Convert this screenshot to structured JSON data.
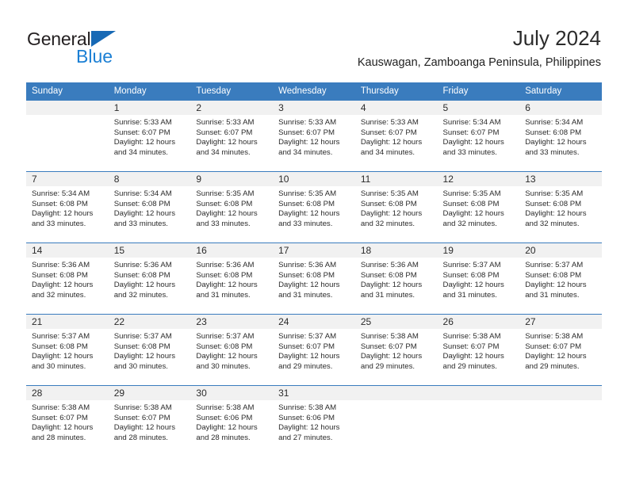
{
  "brand": {
    "name_part1": "General",
    "name_part2": "Blue",
    "triangle_icon": "brand-triangle-icon",
    "accent_color": "#1769b5",
    "secondary_color": "#1b7fd4"
  },
  "header": {
    "title": "July 2024",
    "subtitle": "Kauswagan, Zamboanga Peninsula, Philippines"
  },
  "calendar": {
    "header_bg": "#3a7cbe",
    "daynum_bg": "#f1f1f1",
    "weekday_headers": [
      "Sunday",
      "Monday",
      "Tuesday",
      "Wednesday",
      "Thursday",
      "Friday",
      "Saturday"
    ],
    "weeks": [
      [
        {
          "day": "",
          "sunrise": "",
          "sunset": "",
          "daylight_line1": "",
          "daylight_line2": ""
        },
        {
          "day": "1",
          "sunrise": "Sunrise: 5:33 AM",
          "sunset": "Sunset: 6:07 PM",
          "daylight_line1": "Daylight: 12 hours",
          "daylight_line2": "and 34 minutes."
        },
        {
          "day": "2",
          "sunrise": "Sunrise: 5:33 AM",
          "sunset": "Sunset: 6:07 PM",
          "daylight_line1": "Daylight: 12 hours",
          "daylight_line2": "and 34 minutes."
        },
        {
          "day": "3",
          "sunrise": "Sunrise: 5:33 AM",
          "sunset": "Sunset: 6:07 PM",
          "daylight_line1": "Daylight: 12 hours",
          "daylight_line2": "and 34 minutes."
        },
        {
          "day": "4",
          "sunrise": "Sunrise: 5:33 AM",
          "sunset": "Sunset: 6:07 PM",
          "daylight_line1": "Daylight: 12 hours",
          "daylight_line2": "and 34 minutes."
        },
        {
          "day": "5",
          "sunrise": "Sunrise: 5:34 AM",
          "sunset": "Sunset: 6:07 PM",
          "daylight_line1": "Daylight: 12 hours",
          "daylight_line2": "and 33 minutes."
        },
        {
          "day": "6",
          "sunrise": "Sunrise: 5:34 AM",
          "sunset": "Sunset: 6:08 PM",
          "daylight_line1": "Daylight: 12 hours",
          "daylight_line2": "and 33 minutes."
        }
      ],
      [
        {
          "day": "7",
          "sunrise": "Sunrise: 5:34 AM",
          "sunset": "Sunset: 6:08 PM",
          "daylight_line1": "Daylight: 12 hours",
          "daylight_line2": "and 33 minutes."
        },
        {
          "day": "8",
          "sunrise": "Sunrise: 5:34 AM",
          "sunset": "Sunset: 6:08 PM",
          "daylight_line1": "Daylight: 12 hours",
          "daylight_line2": "and 33 minutes."
        },
        {
          "day": "9",
          "sunrise": "Sunrise: 5:35 AM",
          "sunset": "Sunset: 6:08 PM",
          "daylight_line1": "Daylight: 12 hours",
          "daylight_line2": "and 33 minutes."
        },
        {
          "day": "10",
          "sunrise": "Sunrise: 5:35 AM",
          "sunset": "Sunset: 6:08 PM",
          "daylight_line1": "Daylight: 12 hours",
          "daylight_line2": "and 33 minutes."
        },
        {
          "day": "11",
          "sunrise": "Sunrise: 5:35 AM",
          "sunset": "Sunset: 6:08 PM",
          "daylight_line1": "Daylight: 12 hours",
          "daylight_line2": "and 32 minutes."
        },
        {
          "day": "12",
          "sunrise": "Sunrise: 5:35 AM",
          "sunset": "Sunset: 6:08 PM",
          "daylight_line1": "Daylight: 12 hours",
          "daylight_line2": "and 32 minutes."
        },
        {
          "day": "13",
          "sunrise": "Sunrise: 5:35 AM",
          "sunset": "Sunset: 6:08 PM",
          "daylight_line1": "Daylight: 12 hours",
          "daylight_line2": "and 32 minutes."
        }
      ],
      [
        {
          "day": "14",
          "sunrise": "Sunrise: 5:36 AM",
          "sunset": "Sunset: 6:08 PM",
          "daylight_line1": "Daylight: 12 hours",
          "daylight_line2": "and 32 minutes."
        },
        {
          "day": "15",
          "sunrise": "Sunrise: 5:36 AM",
          "sunset": "Sunset: 6:08 PM",
          "daylight_line1": "Daylight: 12 hours",
          "daylight_line2": "and 32 minutes."
        },
        {
          "day": "16",
          "sunrise": "Sunrise: 5:36 AM",
          "sunset": "Sunset: 6:08 PM",
          "daylight_line1": "Daylight: 12 hours",
          "daylight_line2": "and 31 minutes."
        },
        {
          "day": "17",
          "sunrise": "Sunrise: 5:36 AM",
          "sunset": "Sunset: 6:08 PM",
          "daylight_line1": "Daylight: 12 hours",
          "daylight_line2": "and 31 minutes."
        },
        {
          "day": "18",
          "sunrise": "Sunrise: 5:36 AM",
          "sunset": "Sunset: 6:08 PM",
          "daylight_line1": "Daylight: 12 hours",
          "daylight_line2": "and 31 minutes."
        },
        {
          "day": "19",
          "sunrise": "Sunrise: 5:37 AM",
          "sunset": "Sunset: 6:08 PM",
          "daylight_line1": "Daylight: 12 hours",
          "daylight_line2": "and 31 minutes."
        },
        {
          "day": "20",
          "sunrise": "Sunrise: 5:37 AM",
          "sunset": "Sunset: 6:08 PM",
          "daylight_line1": "Daylight: 12 hours",
          "daylight_line2": "and 31 minutes."
        }
      ],
      [
        {
          "day": "21",
          "sunrise": "Sunrise: 5:37 AM",
          "sunset": "Sunset: 6:08 PM",
          "daylight_line1": "Daylight: 12 hours",
          "daylight_line2": "and 30 minutes."
        },
        {
          "day": "22",
          "sunrise": "Sunrise: 5:37 AM",
          "sunset": "Sunset: 6:08 PM",
          "daylight_line1": "Daylight: 12 hours",
          "daylight_line2": "and 30 minutes."
        },
        {
          "day": "23",
          "sunrise": "Sunrise: 5:37 AM",
          "sunset": "Sunset: 6:08 PM",
          "daylight_line1": "Daylight: 12 hours",
          "daylight_line2": "and 30 minutes."
        },
        {
          "day": "24",
          "sunrise": "Sunrise: 5:37 AM",
          "sunset": "Sunset: 6:07 PM",
          "daylight_line1": "Daylight: 12 hours",
          "daylight_line2": "and 29 minutes."
        },
        {
          "day": "25",
          "sunrise": "Sunrise: 5:38 AM",
          "sunset": "Sunset: 6:07 PM",
          "daylight_line1": "Daylight: 12 hours",
          "daylight_line2": "and 29 minutes."
        },
        {
          "day": "26",
          "sunrise": "Sunrise: 5:38 AM",
          "sunset": "Sunset: 6:07 PM",
          "daylight_line1": "Daylight: 12 hours",
          "daylight_line2": "and 29 minutes."
        },
        {
          "day": "27",
          "sunrise": "Sunrise: 5:38 AM",
          "sunset": "Sunset: 6:07 PM",
          "daylight_line1": "Daylight: 12 hours",
          "daylight_line2": "and 29 minutes."
        }
      ],
      [
        {
          "day": "28",
          "sunrise": "Sunrise: 5:38 AM",
          "sunset": "Sunset: 6:07 PM",
          "daylight_line1": "Daylight: 12 hours",
          "daylight_line2": "and 28 minutes."
        },
        {
          "day": "29",
          "sunrise": "Sunrise: 5:38 AM",
          "sunset": "Sunset: 6:07 PM",
          "daylight_line1": "Daylight: 12 hours",
          "daylight_line2": "and 28 minutes."
        },
        {
          "day": "30",
          "sunrise": "Sunrise: 5:38 AM",
          "sunset": "Sunset: 6:06 PM",
          "daylight_line1": "Daylight: 12 hours",
          "daylight_line2": "and 28 minutes."
        },
        {
          "day": "31",
          "sunrise": "Sunrise: 5:38 AM",
          "sunset": "Sunset: 6:06 PM",
          "daylight_line1": "Daylight: 12 hours",
          "daylight_line2": "and 27 minutes."
        },
        {
          "day": "",
          "sunrise": "",
          "sunset": "",
          "daylight_line1": "",
          "daylight_line2": ""
        },
        {
          "day": "",
          "sunrise": "",
          "sunset": "",
          "daylight_line1": "",
          "daylight_line2": ""
        },
        {
          "day": "",
          "sunrise": "",
          "sunset": "",
          "daylight_line1": "",
          "daylight_line2": ""
        }
      ]
    ]
  }
}
